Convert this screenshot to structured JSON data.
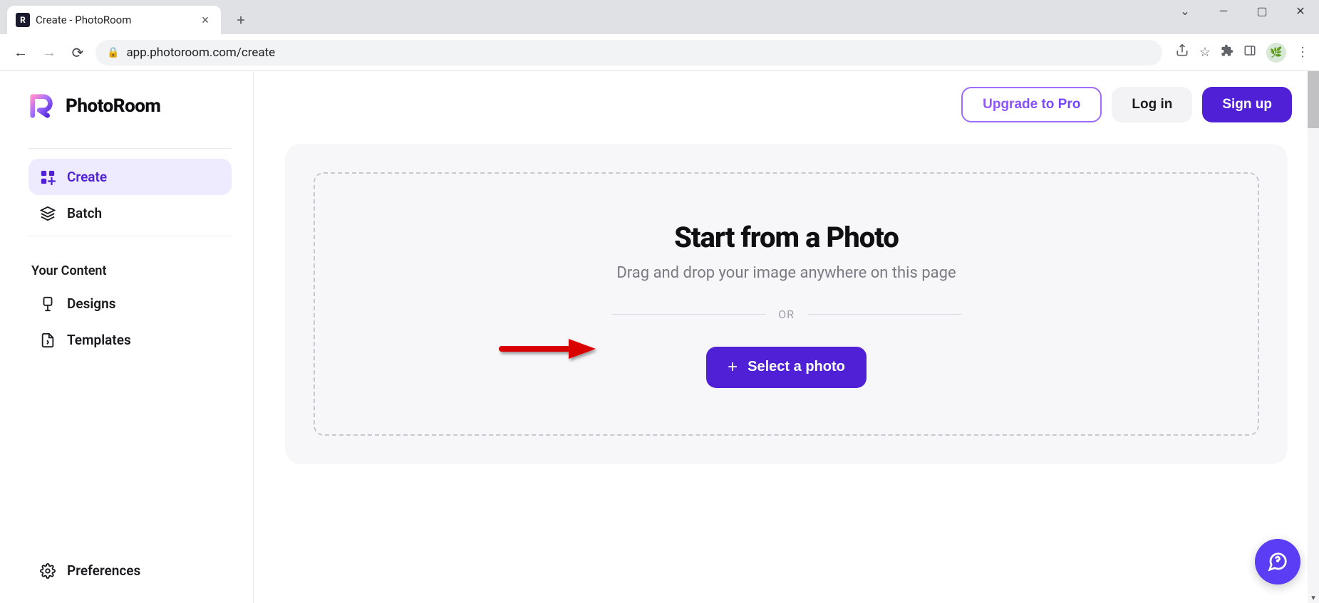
{
  "browser": {
    "tab_title": "Create - PhotoRoom",
    "tab_favicon_letter": "R",
    "url": "app.photoroom.com/create"
  },
  "app": {
    "brand": "PhotoRoom",
    "header": {
      "upgrade": "Upgrade to Pro",
      "login": "Log in",
      "signup": "Sign up"
    },
    "sidebar": {
      "items": [
        {
          "label": "Create",
          "icon": "create",
          "active": true
        },
        {
          "label": "Batch",
          "icon": "batch",
          "active": false
        }
      ],
      "section_label": "Your Content",
      "content_items": [
        {
          "label": "Designs",
          "icon": "designs"
        },
        {
          "label": "Templates",
          "icon": "templates"
        }
      ],
      "preferences": "Preferences"
    },
    "drop": {
      "title": "Start from a Photo",
      "subtitle": "Drag and drop your image anywhere on this page",
      "or": "OR",
      "select_label": "Select a photo"
    }
  }
}
